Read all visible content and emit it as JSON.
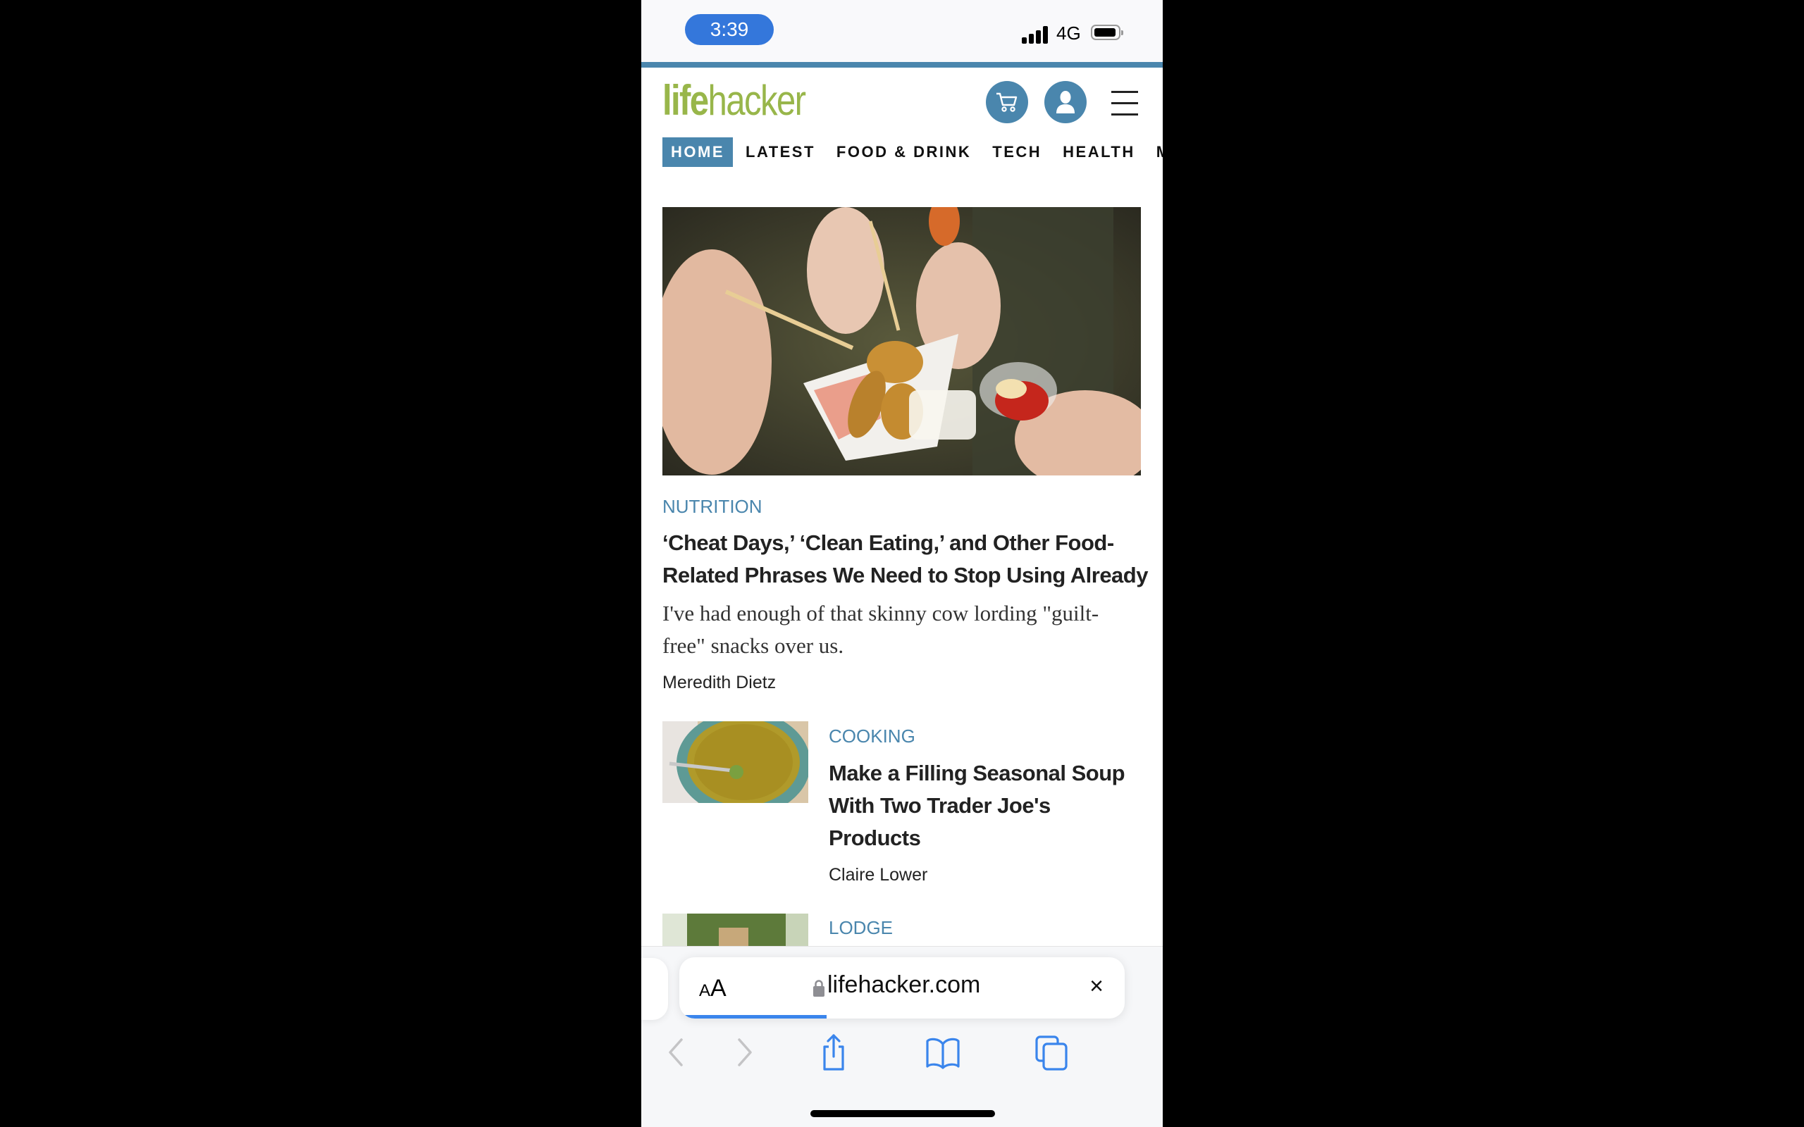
{
  "status_bar": {
    "time": "3:39",
    "network": "4G",
    "battery_level": 0.9,
    "signal_bars": 4
  },
  "site": {
    "logo_bold": "life",
    "logo_light": "hacker",
    "accent_color": "#4a86ad",
    "logo_color": "#98b64a",
    "cart_icon": "cart-icon",
    "account_icon": "user-icon",
    "menu_icon": "hamburger-icon"
  },
  "nav": {
    "items": [
      {
        "label": "HOME",
        "active": true
      },
      {
        "label": "LATEST"
      },
      {
        "label": "FOOD & DRINK"
      },
      {
        "label": "TECH"
      },
      {
        "label": "HEALTH"
      },
      {
        "label": "MORE"
      }
    ]
  },
  "featured": {
    "category": "NUTRITION",
    "headline_line1": "‘Cheat Days,’ ‘Clean Eating,’ and Other Food-",
    "headline_line2": "Related Phrases We Need to Stop Using Already",
    "summary_line1": "I've had enough of that skinny cow lording \"guilt-",
    "summary_line2": "free\" snacks over us.",
    "author": "Meredith Dietz",
    "image_alt": "Hands holding skewers with potato wedges and dipping sauces"
  },
  "articles": [
    {
      "category": "COOKING",
      "headline_lines": [
        "Make a Filling Seasonal Soup",
        "With Two Trader Joe's",
        "Products"
      ],
      "author": "Claire Lower",
      "image_alt": "Bowl of yellow soup with a spoon"
    },
    {
      "category": "LODGE",
      "image_alt": "Green wooden hallway interior"
    }
  ],
  "browser": {
    "text_size_label_small": "A",
    "text_size_label_large": "A",
    "url": "lifehacker.com",
    "close_label": "×",
    "load_progress": 0.33
  }
}
